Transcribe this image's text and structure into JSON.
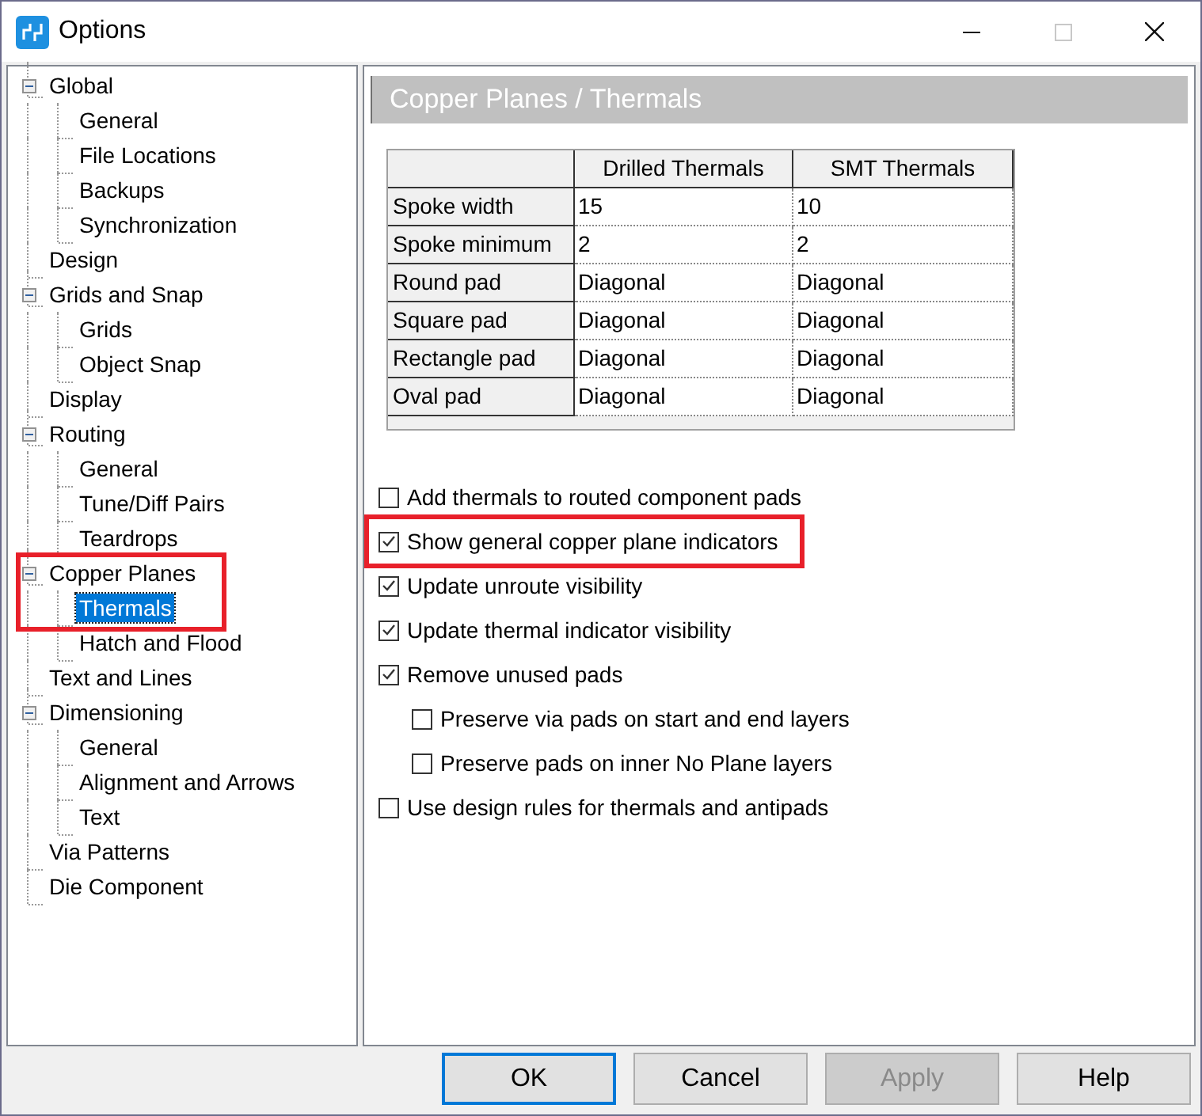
{
  "window": {
    "title": "Options"
  },
  "tree": [
    {
      "label": "Global",
      "expanded": true,
      "selected": false,
      "highlighted": false,
      "children": [
        {
          "label": "General",
          "selected": false
        },
        {
          "label": "File Locations",
          "selected": false
        },
        {
          "label": "Backups",
          "selected": false
        },
        {
          "label": "Synchronization",
          "selected": false
        }
      ]
    },
    {
      "label": "Design",
      "selected": false,
      "highlighted": false
    },
    {
      "label": "Grids and Snap",
      "expanded": true,
      "selected": false,
      "highlighted": false,
      "children": [
        {
          "label": "Grids",
          "selected": false
        },
        {
          "label": "Object Snap",
          "selected": false
        }
      ]
    },
    {
      "label": "Display",
      "selected": false,
      "highlighted": false
    },
    {
      "label": "Routing",
      "expanded": true,
      "selected": false,
      "highlighted": false,
      "children": [
        {
          "label": "General",
          "selected": false
        },
        {
          "label": "Tune/Diff Pairs",
          "selected": false
        },
        {
          "label": "Teardrops",
          "selected": false
        }
      ]
    },
    {
      "label": "Copper Planes",
      "expanded": true,
      "selected": false,
      "highlighted": true,
      "children": [
        {
          "label": "Thermals",
          "selected": true
        },
        {
          "label": "Hatch and Flood",
          "selected": false
        }
      ]
    },
    {
      "label": "Text and Lines",
      "selected": false,
      "highlighted": false
    },
    {
      "label": "Dimensioning",
      "expanded": true,
      "selected": false,
      "highlighted": false,
      "children": [
        {
          "label": "General",
          "selected": false
        },
        {
          "label": "Alignment and Arrows",
          "selected": false
        },
        {
          "label": "Text",
          "selected": false
        }
      ]
    },
    {
      "label": "Via Patterns",
      "selected": false,
      "highlighted": false
    },
    {
      "label": "Die Component",
      "selected": false,
      "highlighted": false
    }
  ],
  "page_title": "Copper Planes / Thermals",
  "table": {
    "columns": [
      "Drilled Thermals",
      "SMT Thermals"
    ],
    "rows": [
      {
        "label": "Spoke width",
        "cells": [
          "15",
          "10"
        ]
      },
      {
        "label": "Spoke minimum",
        "cells": [
          "2",
          "2"
        ]
      },
      {
        "label": "Round pad",
        "cells": [
          "Diagonal",
          "Diagonal"
        ]
      },
      {
        "label": "Square pad",
        "cells": [
          "Diagonal",
          "Diagonal"
        ]
      },
      {
        "label": "Rectangle pad",
        "cells": [
          "Diagonal",
          "Diagonal"
        ]
      },
      {
        "label": "Oval pad",
        "cells": [
          "Diagonal",
          "Diagonal"
        ]
      }
    ]
  },
  "options": [
    {
      "label": "Add thermals to routed component pads",
      "checked": false,
      "highlighted": false
    },
    {
      "label": "Show general copper plane indicators",
      "checked": true,
      "highlighted": true
    },
    {
      "label": "Update unroute visibility",
      "checked": true,
      "highlighted": false
    },
    {
      "label": "Update thermal indicator visibility",
      "checked": true,
      "highlighted": false
    },
    {
      "label": "Remove unused pads",
      "checked": true,
      "highlighted": false,
      "children": [
        {
          "label": "Preserve via pads on start and end layers",
          "checked": false
        },
        {
          "label": "Preserve pads on inner No Plane layers",
          "checked": false
        }
      ]
    },
    {
      "label": "Use design rules for thermals and antipads",
      "checked": false,
      "highlighted": false
    }
  ],
  "buttons": [
    {
      "label": "OK",
      "default": true,
      "disabled": false
    },
    {
      "label": "Cancel",
      "default": false,
      "disabled": false
    },
    {
      "label": "Apply",
      "default": false,
      "disabled": true
    },
    {
      "label": "Help",
      "default": false,
      "disabled": false
    }
  ]
}
